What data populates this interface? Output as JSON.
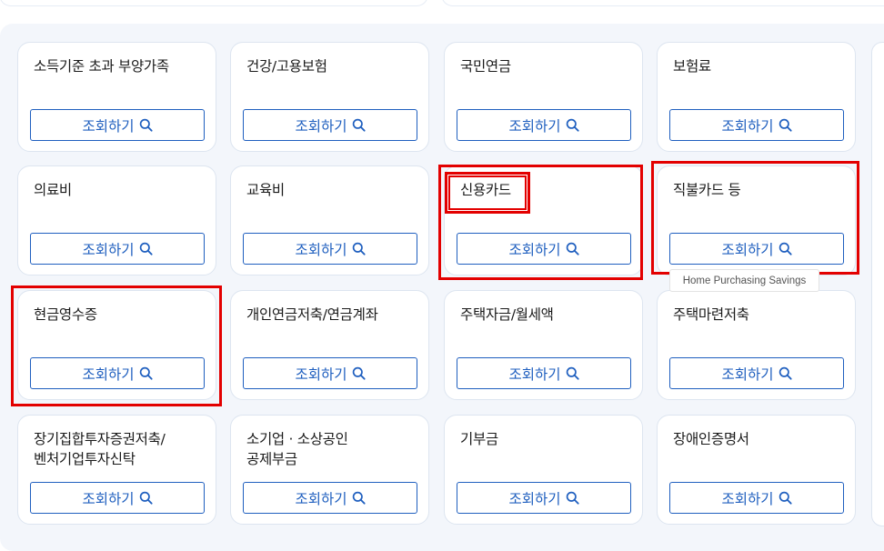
{
  "search_label": "조회하기",
  "tooltip_text": "Home Purchasing Savings",
  "colors": {
    "accent": "#1f5fbf",
    "highlight": "#e30000",
    "panel": "#f3f6fb"
  },
  "icons": {
    "search": "search-icon"
  },
  "cards": [
    {
      "title": "소득기준 초과 부양가족"
    },
    {
      "title": "건강/고용보험"
    },
    {
      "title": "국민연금"
    },
    {
      "title": "보험료"
    },
    {
      "title": "의료비"
    },
    {
      "title": "교육비"
    },
    {
      "title": "신용카드"
    },
    {
      "title": "직불카드 등"
    },
    {
      "title": "현금영수증"
    },
    {
      "title": "개인연금저축/연금계좌"
    },
    {
      "title": "주택자금/월세액"
    },
    {
      "title": "주택마련저축"
    },
    {
      "title": "장기집합투자증권저축/\n벤처기업투자신탁"
    },
    {
      "title": "소기업 · 소상공인\n공제부금"
    },
    {
      "title": "기부금"
    },
    {
      "title": "장애인증명서"
    }
  ]
}
